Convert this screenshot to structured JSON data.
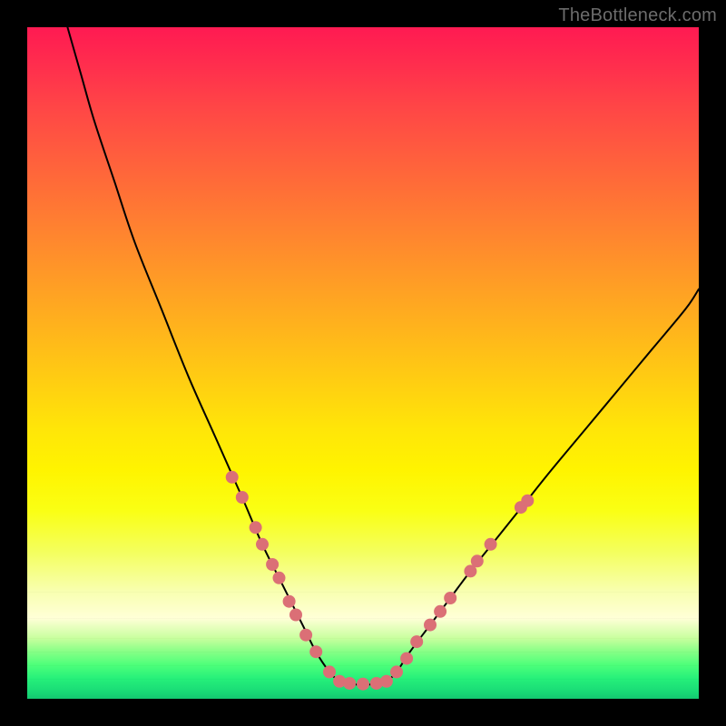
{
  "watermark": "TheBottleneck.com",
  "chart_data": {
    "type": "line",
    "title": "",
    "xlabel": "",
    "ylabel": "",
    "xlim": [
      0,
      100
    ],
    "ylim": [
      0,
      100
    ],
    "grid": false,
    "legend": false,
    "annotations": [],
    "background_gradient": {
      "direction": "vertical",
      "stops": [
        {
          "pos": 0.0,
          "color": "#ff1a52"
        },
        {
          "pos": 0.3,
          "color": "#ff8230"
        },
        {
          "pos": 0.6,
          "color": "#ffe608"
        },
        {
          "pos": 0.85,
          "color": "#f8ffb0"
        },
        {
          "pos": 0.93,
          "color": "#86ff86"
        },
        {
          "pos": 1.0,
          "color": "#14c870"
        }
      ]
    },
    "series": [
      {
        "name": "left-branch",
        "x": [
          6,
          8,
          10,
          13,
          16,
          20,
          24,
          28,
          32,
          35,
          38,
          41,
          43,
          45,
          46.5
        ],
        "y": [
          100,
          93,
          86,
          77,
          68,
          58,
          48,
          39,
          30,
          23,
          17,
          11,
          7,
          4,
          2.5
        ],
        "color": "#000000",
        "stroke_width": 2
      },
      {
        "name": "right-branch",
        "x": [
          53.5,
          55,
          57,
          60,
          63,
          66,
          70,
          74,
          78,
          83,
          88,
          93,
          98,
          100
        ],
        "y": [
          2.5,
          4,
          7,
          11,
          15,
          19,
          24,
          29,
          34,
          40,
          46,
          52,
          58,
          61
        ],
        "color": "#000000",
        "stroke_width": 2
      },
      {
        "name": "valley-floor",
        "x": [
          46.5,
          48,
          50,
          52,
          53.5
        ],
        "y": [
          2.5,
          2.2,
          2.1,
          2.2,
          2.5
        ],
        "color": "#000000",
        "stroke_width": 2
      }
    ],
    "markers": [
      {
        "name": "left-dots",
        "color": "#db6f76",
        "radius": 7,
        "points": [
          {
            "x": 30.5,
            "y": 33
          },
          {
            "x": 32.0,
            "y": 30
          },
          {
            "x": 34.0,
            "y": 25.5
          },
          {
            "x": 35.0,
            "y": 23
          },
          {
            "x": 36.5,
            "y": 20
          },
          {
            "x": 37.5,
            "y": 18
          },
          {
            "x": 39.0,
            "y": 14.5
          },
          {
            "x": 40.0,
            "y": 12.5
          },
          {
            "x": 41.5,
            "y": 9.5
          },
          {
            "x": 43.0,
            "y": 7
          },
          {
            "x": 45.0,
            "y": 4
          }
        ]
      },
      {
        "name": "bottom-dots",
        "color": "#db6f76",
        "radius": 7,
        "points": [
          {
            "x": 46.5,
            "y": 2.6
          },
          {
            "x": 48.0,
            "y": 2.3
          },
          {
            "x": 50.0,
            "y": 2.2
          },
          {
            "x": 52.0,
            "y": 2.3
          },
          {
            "x": 53.5,
            "y": 2.6
          }
        ]
      },
      {
        "name": "right-dots",
        "color": "#db6f76",
        "radius": 7,
        "points": [
          {
            "x": 55.0,
            "y": 4
          },
          {
            "x": 56.5,
            "y": 6
          },
          {
            "x": 58.0,
            "y": 8.5
          },
          {
            "x": 60.0,
            "y": 11
          },
          {
            "x": 61.5,
            "y": 13
          },
          {
            "x": 63.0,
            "y": 15
          },
          {
            "x": 66.0,
            "y": 19
          },
          {
            "x": 67.0,
            "y": 20.5
          },
          {
            "x": 69.0,
            "y": 23
          },
          {
            "x": 73.5,
            "y": 28.5
          },
          {
            "x": 74.5,
            "y": 29.5
          }
        ]
      }
    ]
  }
}
